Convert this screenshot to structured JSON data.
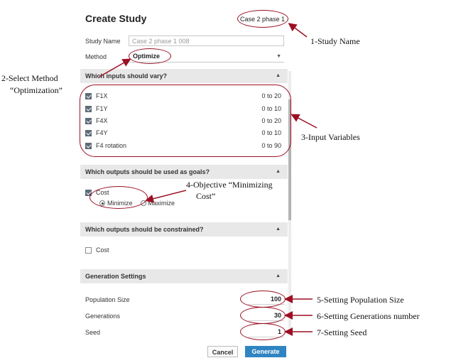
{
  "dialog": {
    "title": "Create Study",
    "case_name": "Case 2 phase 1",
    "study_name_label": "Study Name",
    "study_name_value": "Case 2 phase 1 008",
    "method_label": "Method",
    "method_value": "Optimize"
  },
  "sections": {
    "inputs_vary": "Which inputs should vary?",
    "goals": "Which outputs should be used as goals?",
    "constrained": "Which outputs should be constrained?",
    "generation": "Generation Settings"
  },
  "inputs": [
    {
      "name": "F1X",
      "range": "0 to 20",
      "checked": true
    },
    {
      "name": "F1Y",
      "range": "0 to 10",
      "checked": true
    },
    {
      "name": "F4X",
      "range": "0 to 20",
      "checked": true
    },
    {
      "name": "F4Y",
      "range": "0 to 10",
      "checked": true
    },
    {
      "name": "F4 rotation",
      "range": "0 to 90",
      "checked": true
    }
  ],
  "goals": {
    "output": "Cost",
    "minimize": "Minimize",
    "maximize": "Maximize",
    "selected": "Minimize"
  },
  "constraints": {
    "output": "Cost",
    "checked": false
  },
  "generation": {
    "population_label": "Population Size",
    "population_value": "100",
    "generations_label": "Generations",
    "generations_value": "30",
    "seed_label": "Seed",
    "seed_value": "1"
  },
  "buttons": {
    "cancel": "Cancel",
    "generate": "Generate"
  },
  "annotations": {
    "a1": "1-Study Name",
    "a2_line1": "2-Select Method",
    "a2_line2": "“Optimization”",
    "a3": "3-Input Variables",
    "a4_line1": "4-Objective “Minimizing",
    "a4_line2": "Cost”",
    "a5": "5-Setting Population Size",
    "a6": "6-Setting Generations number",
    "a7": "7-Setting Seed"
  },
  "colors": {
    "annotation": "#9b0f23",
    "generate_button": "#2f84c2",
    "section_header": "#e8e8e8"
  }
}
